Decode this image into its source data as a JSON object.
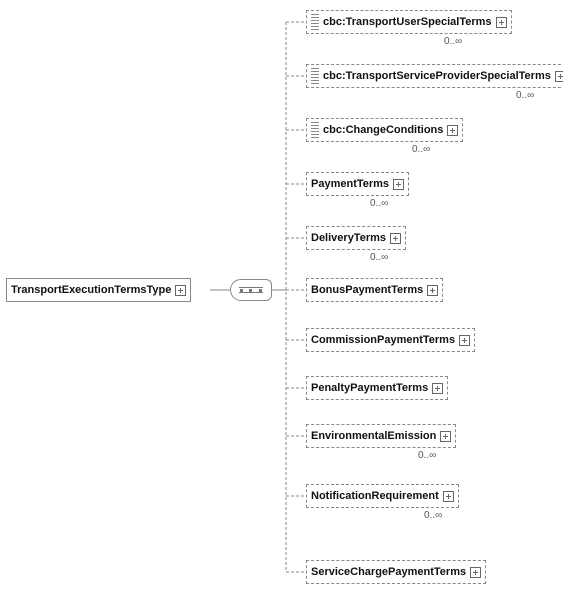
{
  "root": {
    "label": "TransportExecutionTermsType"
  },
  "children": {
    "n0": {
      "label": "cbc:TransportUserSpecialTerms",
      "card": "0..∞"
    },
    "n1": {
      "label": "cbc:TransportServiceProviderSpecialTerms",
      "card": "0..∞"
    },
    "n2": {
      "label": "cbc:ChangeConditions",
      "card": "0..∞"
    },
    "n3": {
      "label": "PaymentTerms",
      "card": "0..∞"
    },
    "n4": {
      "label": "DeliveryTerms",
      "card": "0..∞"
    },
    "n5": {
      "label": "BonusPaymentTerms",
      "card": ""
    },
    "n6": {
      "label": "CommissionPaymentTerms",
      "card": ""
    },
    "n7": {
      "label": "PenaltyPaymentTerms",
      "card": ""
    },
    "n8": {
      "label": "EnvironmentalEmission",
      "card": "0..∞"
    },
    "n9": {
      "label": "NotificationRequirement",
      "card": "0..∞"
    },
    "n10": {
      "label": "ServiceChargePaymentTerms",
      "card": ""
    }
  },
  "icons": {
    "plus": "+"
  }
}
